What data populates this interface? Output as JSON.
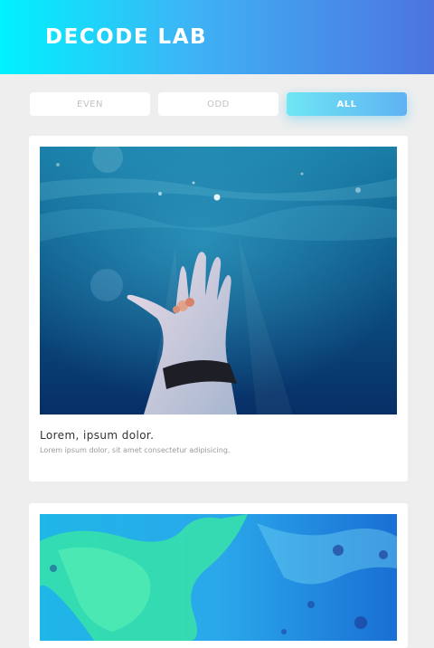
{
  "header": {
    "brand": "DECODE LAB"
  },
  "filters": [
    {
      "label": "EVEN",
      "active": false
    },
    {
      "label": "ODD",
      "active": false
    },
    {
      "label": "ALL",
      "active": true
    }
  ],
  "cards": [
    {
      "image_icon": "underwater-hand-photo",
      "title": "Lorem, ipsum dolor.",
      "description": "Lorem ipsum dolor, sit amet consectetur adipisicing."
    },
    {
      "image_icon": "abstract-fluid-paint-photo"
    }
  ],
  "colors": {
    "header_gradient_start": "#00f2fe",
    "header_gradient_end": "#4d74e0",
    "active_filter_start": "#6ee6f4",
    "active_filter_end": "#5fb2f2",
    "background": "#eeeeee"
  }
}
